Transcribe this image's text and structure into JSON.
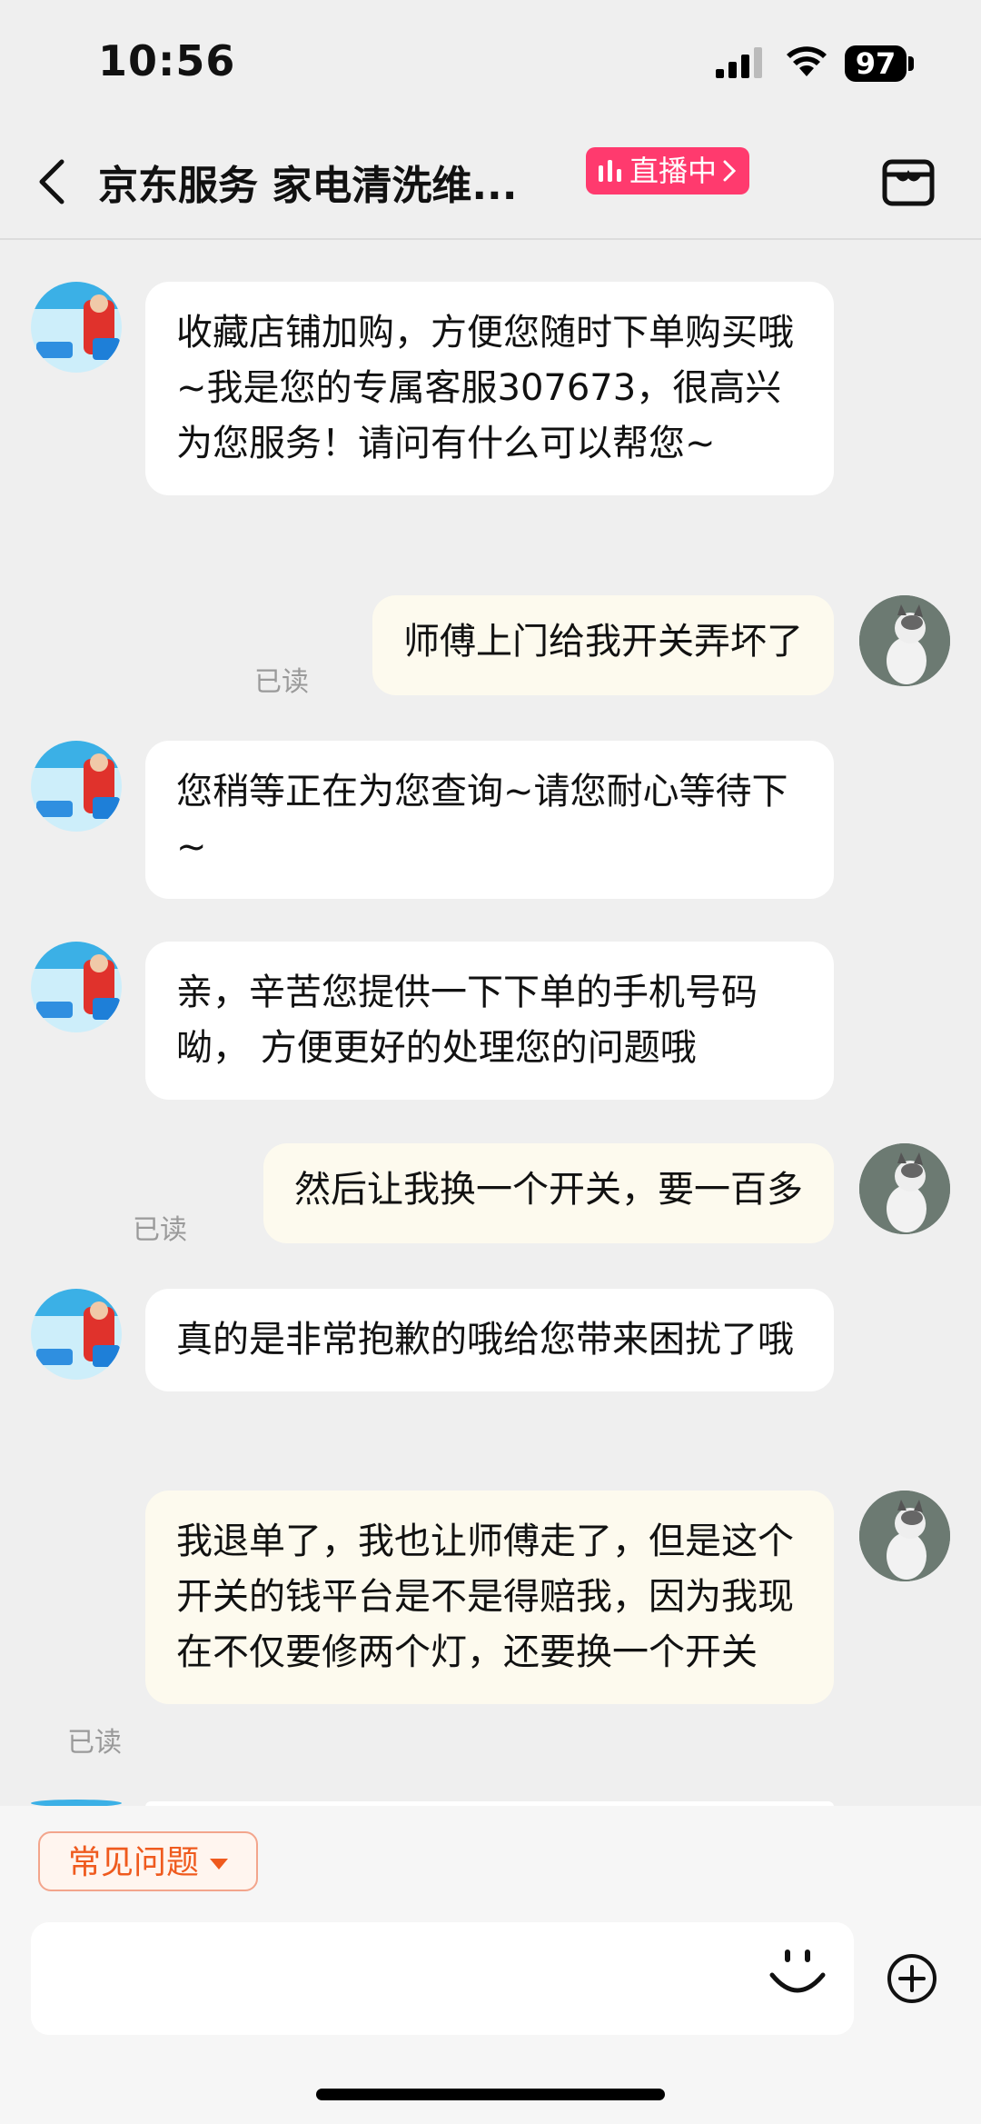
{
  "status": {
    "time": "10:56",
    "battery": "97"
  },
  "nav": {
    "title": "京东服务 家电清洗维...",
    "live_label": "直播中"
  },
  "messages": [
    {
      "from": "shop",
      "text": "收藏店铺加购，方便您随时下单购买哦~我是您的专属客服307673，很高兴为您服务！请问有什么可以帮您~"
    },
    {
      "from": "user",
      "text": "师傅上门给我开关弄坏了",
      "status": "已读"
    },
    {
      "from": "shop",
      "text": "您稍等正在为您查询~请您耐心等待下 ~"
    },
    {
      "from": "shop",
      "text": "亲，辛苦您提供一下下单的手机号码呦， 方便更好的处理您的问题哦"
    },
    {
      "from": "user",
      "text": "然后让我换一个开关，要一百多",
      "status": "已读"
    },
    {
      "from": "shop",
      "text": "真的是非常抱歉的哦给您带来困扰了哦"
    },
    {
      "from": "user",
      "text": "我退单了，我也让师傅走了，但是这个开关的钱平台是不是得赔我，因为我现在不仅要修两个灯，还要换一个开关",
      "status": "已读"
    }
  ],
  "bottom": {
    "faq_label": "常见问题"
  },
  "colors": {
    "live_badge": "#ff3a6e",
    "faq_accent": "#ef5a1e",
    "user_bubble": "#fdfaee",
    "background": "#efefef"
  }
}
